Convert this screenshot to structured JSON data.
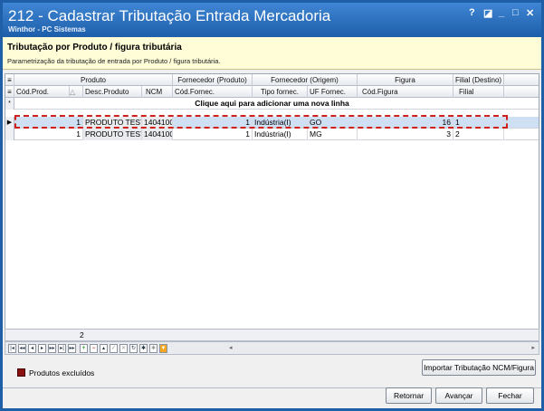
{
  "window": {
    "title": "212 - Cadastrar Tributação Entrada Mercadoria",
    "subtitle": "Winthor - PC Sistemas",
    "controls": {
      "help": "?",
      "restore": "◪",
      "minimize": "_",
      "maximize": "□",
      "close": "✕"
    }
  },
  "header": {
    "title": "Tributação por Produto / figura tributária",
    "description": "Parametrização da tributação de entrada por Produto / figura tributária."
  },
  "grid": {
    "group_headers": [
      "Produto",
      "Fornecedor (Produto)",
      "Fornecedor (Origem)",
      "Figura",
      "Filial (Destino)"
    ],
    "columns": [
      "Cód.Prod.",
      "Desc.Produto",
      "NCM",
      "Cód.Fornec.",
      "Tipo fornec.",
      "UF Fornec.",
      "Cód.Figura",
      "Filial"
    ],
    "add_row_text": "Clique aqui para adicionar uma nova linha",
    "rows": [
      {
        "cod_prod": "1",
        "desc": "PRODUTO TESTE",
        "ncm": "1404100",
        "cod_fornec": "1",
        "tipo": "Indústria(I)",
        "uf": "GO",
        "cod_figura": "16",
        "filial": "1"
      },
      {
        "cod_prod": "1",
        "desc": "PRODUTO TESTE",
        "ncm": "1404100",
        "cod_fornec": "1",
        "tipo": "Indústria(I)",
        "uf": "MG",
        "cod_figura": "3",
        "filial": "2"
      }
    ],
    "row_count": "2"
  },
  "legend": {
    "label": "Produtos excluídos",
    "color": "#8b1010"
  },
  "buttons": {
    "importar": "Importar Tributação NCM/Figura",
    "retornar": "Retornar",
    "avancar": "Avançar",
    "fechar": "Fechar"
  }
}
